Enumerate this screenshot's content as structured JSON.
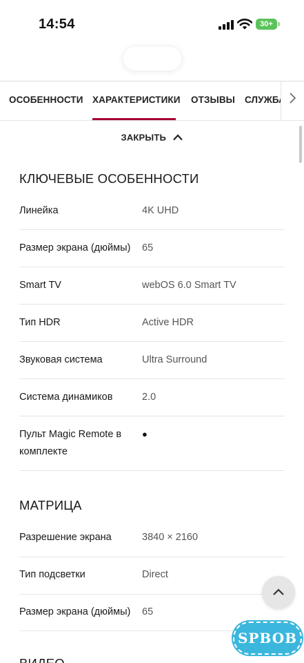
{
  "status_bar": {
    "time": "14:54",
    "battery": "30+",
    "icons": [
      "cellular-signal-icon",
      "wifi-icon",
      "battery-icon"
    ]
  },
  "tabs": [
    {
      "label": "ОСОБЕННОСТИ",
      "active": false
    },
    {
      "label": "ХАРАКТЕРИСТИКИ",
      "active": true
    },
    {
      "label": "ОТЗЫВЫ",
      "active": false
    },
    {
      "label": "СЛУЖБА",
      "active": false
    }
  ],
  "close_toggle": {
    "label": "ЗАКРЫТЬ",
    "icon": "chevron-up-icon"
  },
  "sections": [
    {
      "title": "КЛЮЧЕВЫЕ ОСОБЕННОСТИ",
      "rows": [
        {
          "label": "Линейка",
          "value": "4K UHD"
        },
        {
          "label": "Размер экрана (дюймы)",
          "value": "65"
        },
        {
          "label": "Smart TV",
          "value": "webOS 6.0 Smart TV"
        },
        {
          "label": "Тип HDR",
          "value": "Active HDR"
        },
        {
          "label": "Звуковая система",
          "value": "Ultra Surround"
        },
        {
          "label": "Система динамиков",
          "value": "2.0"
        },
        {
          "label": "Пульт Magic Remote в комплекте",
          "value": "●"
        }
      ]
    },
    {
      "title": "МАТРИЦА",
      "rows": [
        {
          "label": "Разрешение экрана",
          "value": "3840 × 2160"
        },
        {
          "label": "Тип подсветки",
          "value": "Direct"
        },
        {
          "label": "Размер экрана (дюймы)",
          "value": "65"
        }
      ]
    },
    {
      "title": "ВИДЕО",
      "rows": []
    }
  ],
  "scroll_top_button": {
    "icon": "chevron-up-icon"
  },
  "watermark": {
    "text": "SPBOB"
  },
  "colors": {
    "accent": "#a50034",
    "battery": "#5ac35a",
    "watermark": "#3bb7dd"
  }
}
